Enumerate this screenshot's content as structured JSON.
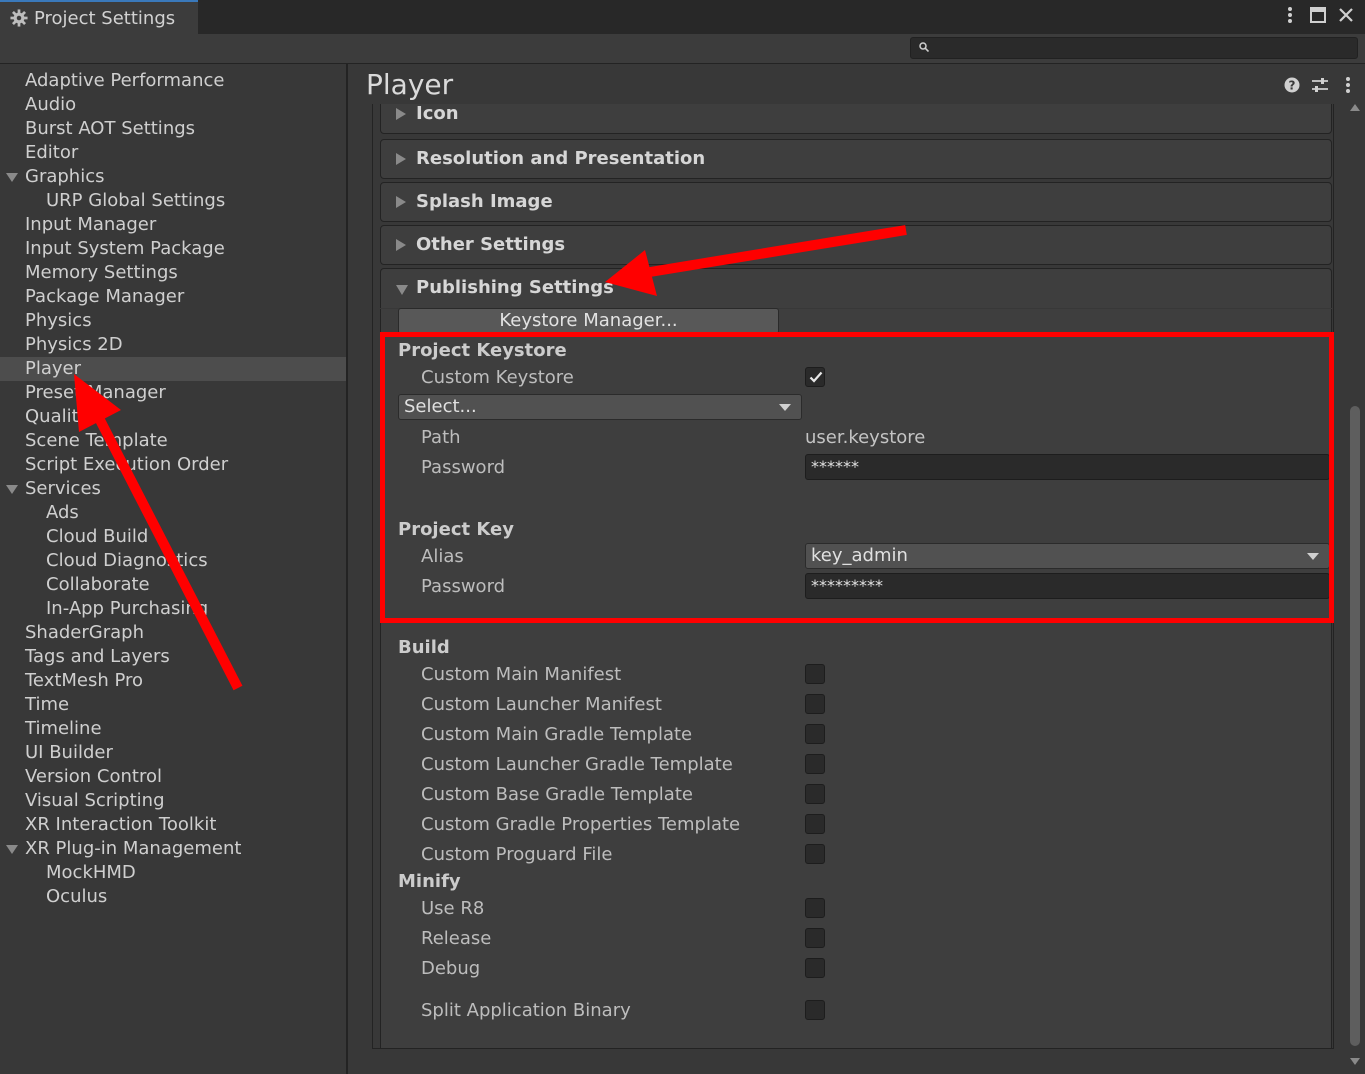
{
  "window": {
    "tab_title": "Project Settings"
  },
  "search": {
    "placeholder": ""
  },
  "sidebar": {
    "items": [
      {
        "label": "Adaptive Performance"
      },
      {
        "label": "Audio"
      },
      {
        "label": "Burst AOT Settings"
      },
      {
        "label": "Editor"
      },
      {
        "label": "Graphics"
      },
      {
        "label": "URP Global Settings"
      },
      {
        "label": "Input Manager"
      },
      {
        "label": "Input System Package"
      },
      {
        "label": "Memory Settings"
      },
      {
        "label": "Package Manager"
      },
      {
        "label": "Physics"
      },
      {
        "label": "Physics 2D"
      },
      {
        "label": "Player"
      },
      {
        "label": "Preset Manager"
      },
      {
        "label": "Quality"
      },
      {
        "label": "Scene Template"
      },
      {
        "label": "Script Execution Order"
      },
      {
        "label": "Services"
      },
      {
        "label": "Ads"
      },
      {
        "label": "Cloud Build"
      },
      {
        "label": "Cloud Diagnostics"
      },
      {
        "label": "Collaborate"
      },
      {
        "label": "In-App Purchasing"
      },
      {
        "label": "ShaderGraph"
      },
      {
        "label": "Tags and Layers"
      },
      {
        "label": "TextMesh Pro"
      },
      {
        "label": "Time"
      },
      {
        "label": "Timeline"
      },
      {
        "label": "UI Builder"
      },
      {
        "label": "Version Control"
      },
      {
        "label": "Visual Scripting"
      },
      {
        "label": "XR Interaction Toolkit"
      },
      {
        "label": "XR Plug-in Management"
      },
      {
        "label": "MockHMD"
      },
      {
        "label": "Oculus"
      }
    ],
    "selected": "Player"
  },
  "main": {
    "title": "Player",
    "foldouts": [
      {
        "label": "Icon"
      },
      {
        "label": "Resolution and Presentation"
      },
      {
        "label": "Splash Image"
      },
      {
        "label": "Other Settings"
      },
      {
        "label": "Publishing Settings"
      }
    ],
    "publishing": {
      "keystore_manager_button": "Keystore Manager...",
      "project_keystore": {
        "title": "Project Keystore",
        "custom_keystore_label": "Custom Keystore",
        "custom_keystore_checked": true,
        "select_dropdown": "Select...",
        "path_label": "Path",
        "path_value": "user.keystore",
        "password_label": "Password",
        "password_value": "******"
      },
      "project_key": {
        "title": "Project Key",
        "alias_label": "Alias",
        "alias_value": "key_admin",
        "password_label": "Password",
        "password_value": "*********"
      },
      "build": {
        "title": "Build",
        "options": [
          {
            "label": "Custom Main Manifest",
            "checked": false
          },
          {
            "label": "Custom Launcher Manifest",
            "checked": false
          },
          {
            "label": "Custom Main Gradle Template",
            "checked": false
          },
          {
            "label": "Custom Launcher Gradle Template",
            "checked": false
          },
          {
            "label": "Custom Base Gradle Template",
            "checked": false
          },
          {
            "label": "Custom Gradle Properties Template",
            "checked": false
          },
          {
            "label": "Custom Proguard File",
            "checked": false
          }
        ]
      },
      "minify": {
        "title": "Minify",
        "options": [
          {
            "label": "Use R8",
            "checked": false
          },
          {
            "label": "Release",
            "checked": false
          },
          {
            "label": "Debug",
            "checked": false
          }
        ]
      },
      "split_binary": {
        "label": "Split Application Binary",
        "checked": false
      }
    }
  },
  "colors": {
    "annotation": "#ff0000",
    "selection": "#4d4d4d",
    "tab_accent": "#3a79bb"
  }
}
